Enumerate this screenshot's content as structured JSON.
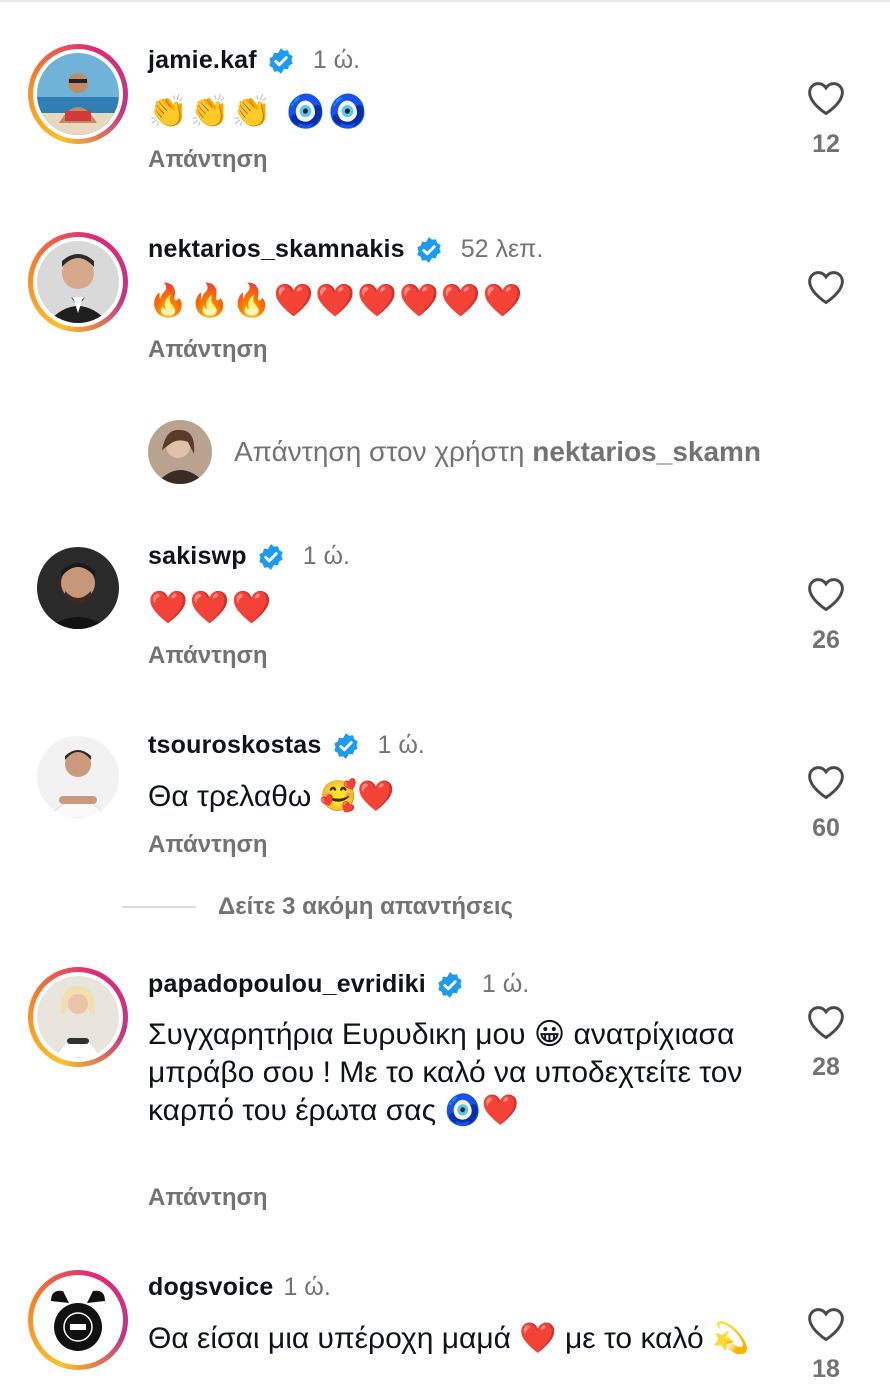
{
  "comments": [
    {
      "username": "jamie.kaf",
      "verified": true,
      "time": "1 ώ.",
      "text": "👏👏👏 🧿🧿",
      "reply_label": "Απάντηση",
      "likes": "12"
    },
    {
      "username": "nektarios_skamnakis",
      "verified": true,
      "time": "52 λεπ.",
      "text": "🔥🔥🔥❤️❤️❤️❤️❤️❤️",
      "reply_label": "Απάντηση",
      "likes": ""
    },
    {
      "username": "sakiswp",
      "verified": true,
      "time": "1 ώ.",
      "text": "❤️❤️❤️",
      "reply_label": "Απάντηση",
      "likes": "26"
    },
    {
      "username": "tsouroskostas",
      "verified": true,
      "time": "1 ώ.",
      "text": "Θα τρελαθω 🥰❤️",
      "reply_label": "Απάντηση",
      "likes": "60"
    },
    {
      "username": "papadopoulou_evridiki",
      "verified": true,
      "time": "1 ώ.",
      "text": "Συγχαρητήρια Ευρυδικη μου 😀 ανατρίχιασα μπράβο σου ! Με το καλό να υποδεχτείτε τον καρπό του έρωτα σας 🧿❤️",
      "reply_label": "Απάντηση",
      "likes": "28"
    },
    {
      "username": "dogsvoice",
      "verified": false,
      "time": "1 ώ.",
      "text": "Θα είσαι μια υπέροχη μαμά ❤️ με το καλό 💫",
      "reply_label": "",
      "likes": "18"
    }
  ],
  "reply_prompt": {
    "prefix": "Απάντηση στον χρήστη",
    "username": "nektarios_skamnakis"
  },
  "view_more": "Δείτε 3 ακόμη απαντήσεις",
  "colors": {
    "verified_badge": "#1d9bf0",
    "secondary_text": "#737373",
    "story_ring": "#dd2a7b"
  }
}
